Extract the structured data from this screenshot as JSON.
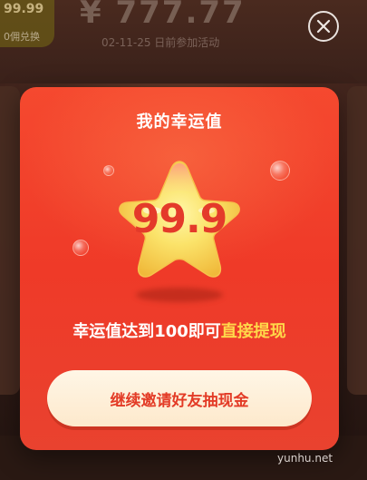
{
  "background": {
    "badge_value": "99.99",
    "badge_sub": "0佣兑换",
    "amount": "¥ 777.77",
    "date_line": "02-11-25 日前参加活动"
  },
  "modal": {
    "title": "我的幸运值",
    "lucky_value": "99.9",
    "hint_prefix": "幸运值达到100即可",
    "hint_highlight": "直接提现",
    "cta_label": "继续邀请好友抽现金"
  },
  "watermark": "yunhu.net",
  "colors": {
    "modal_top": "#f5492f",
    "highlight": "#ffd84a",
    "cta_text": "#e33b26",
    "star": "#f7d24a"
  },
  "icons": {
    "close": "close-icon",
    "star": "star-icon"
  }
}
